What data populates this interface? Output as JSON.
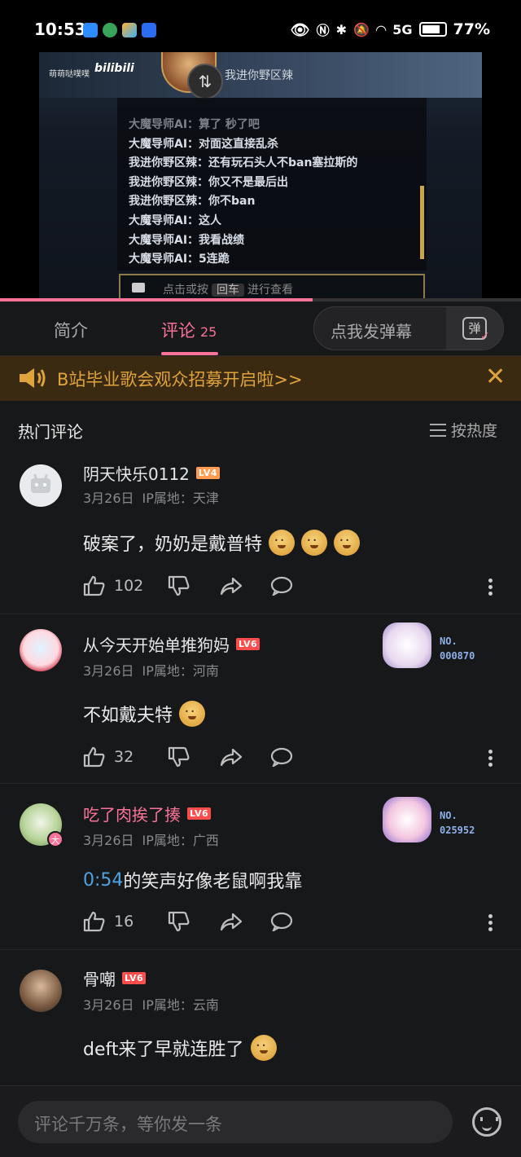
{
  "status_bar": {
    "time": "10:53",
    "signal_label": "5G",
    "battery": "77%",
    "battery_level": 0.77
  },
  "video": {
    "watermark_text": "萌萌哒噗噗",
    "watermark_logo": "bilibili",
    "banner_name": "我进你野区辣",
    "chat_lines": [
      "大魔导师AI：算了 秒了吧",
      "大魔导师AI：对面这直接乱杀",
      "我进你野区辣：还有玩石头人不ban塞拉斯的",
      "我进你野区辣：你又不是最后出",
      "我进你野区辣：你不ban",
      "大魔导师AI：这人",
      "大魔导师AI：我看战绩",
      "大魔导师AI：5连跪"
    ],
    "chat_input_prefix": "点击或按",
    "chat_input_key": "回车",
    "chat_input_suffix": "进行查看",
    "progress": 0.6
  },
  "tabs": {
    "intro": "简介",
    "comments": "评论",
    "comments_count": "25",
    "danmaku_button": "点我发弹幕",
    "danmaku_icon_text": "弹"
  },
  "notice": {
    "text": "B站毕业歌会观众招募开启啦>>",
    "close": "✕"
  },
  "section": {
    "title": "热门评论",
    "sort_label": "按热度"
  },
  "comments": [
    {
      "name": "阴天快乐0112",
      "level": "LV4",
      "date": "3月26日",
      "ip": "IP属地：天津",
      "text": "破案了，奶奶是戴普特",
      "likes": "102"
    },
    {
      "name": "从今天开始单推狗妈",
      "level": "LV6",
      "date": "3月26日",
      "ip": "IP属地：河南",
      "text": "不如戴夫特",
      "likes": "32",
      "fan_no_label": "NO.",
      "fan_no": "000870"
    },
    {
      "name": "吃了肉挨了揍",
      "level": "LV6",
      "date": "3月26日",
      "ip": "IP属地：广西",
      "timestamp": "0:54",
      "text": " 的笑声好像老鼠啊我靠",
      "likes": "16",
      "fan_no_label": "NO.",
      "fan_no": "025952",
      "avatar_badge": "大"
    },
    {
      "name": "骨嘲",
      "level": "LV6",
      "date": "3月26日",
      "ip": "IP属地：云南",
      "text": "deft来了早就连胜了"
    }
  ],
  "bottom_bar": {
    "placeholder": "评论千万条，等你发一条"
  },
  "colors": {
    "accent": "#fb7299",
    "notice": "#e0a33c",
    "timestamp": "#4fa3e3"
  }
}
